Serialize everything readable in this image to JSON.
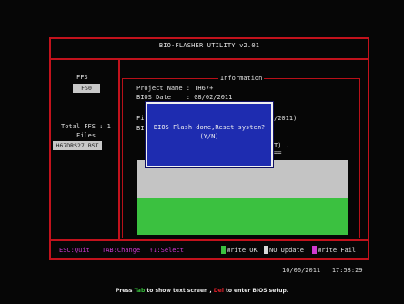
{
  "window": {
    "title": "BIO-FLASHER UTILITY v2.01"
  },
  "left_panel": {
    "ffs_label": "FFS",
    "ffs_value": "FS0",
    "total_ffs": "Total FFS : 1",
    "files_label": "Files",
    "files": [
      "H67DRS27.BST"
    ]
  },
  "info_panel": {
    "label": "Information",
    "project_line": "Project Name : TH67+",
    "date_line": "BIOS Date    : 08/02/2011",
    "partial_line_1_start": "Fi",
    "partial_line_1_end": "/2011)",
    "partial_line_2_start": "BI",
    "partial_line_3_end": "T)...",
    "partial_line_4_end": "==",
    "progress": {
      "written_fraction": 0.49
    }
  },
  "dialog": {
    "message": "BIOS Flash done,Reset system?",
    "prompt": "(Y/N)"
  },
  "hints": {
    "esc": "ESC:Quit",
    "tab": "TAB:Change",
    "arrows": "↑↓:Select"
  },
  "legend": {
    "write_ok": "Write OK",
    "no_update": "NO Update",
    "write_fail": "Write Fail",
    "colors": {
      "write_ok": "#3bc140",
      "no_update": "#d8d8d8",
      "write_fail": "#d03ad0"
    }
  },
  "status": {
    "date": "10/06/2011",
    "time": "17:58:29"
  },
  "footer": {
    "prefix": "Press ",
    "tab_key": "Tab",
    "middle": " to show text screen , ",
    "del_key": "Del",
    "suffix": " to enter BIOS setup."
  },
  "colors": {
    "frame": "#c2121c",
    "dialog_bg": "#1e2cb0",
    "progress_done": "#3bc140",
    "progress_pending": "#c4c4c4"
  }
}
